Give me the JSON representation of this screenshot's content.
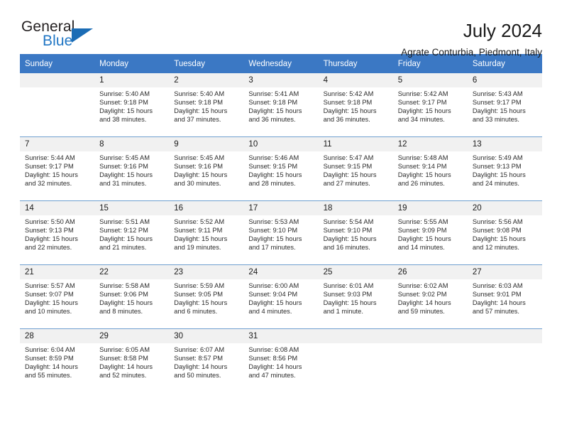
{
  "brand": {
    "name_top": "General",
    "name_bottom": "Blue",
    "triangle_color": "#1b6cb5",
    "blue_text_color": "#2076c4"
  },
  "header": {
    "title": "July 2024",
    "subtitle": "Agrate Conturbia, Piedmont, Italy"
  },
  "theme": {
    "header_bar_color": "#3b78c4",
    "daynum_band_color": "#f1f1f1",
    "row_separator_color": "#6f9fd0",
    "text_color": "#1a1a1a"
  },
  "weekday_headers": [
    "Sunday",
    "Monday",
    "Tuesday",
    "Wednesday",
    "Thursday",
    "Friday",
    "Saturday"
  ],
  "weeks": [
    [
      {
        "day": "",
        "empty": true,
        "sunrise": "",
        "sunset": "",
        "daylight_line1": "",
        "daylight_line2": ""
      },
      {
        "day": "1",
        "empty": false,
        "sunrise": "Sunrise: 5:40 AM",
        "sunset": "Sunset: 9:18 PM",
        "daylight_line1": "Daylight: 15 hours",
        "daylight_line2": "and 38 minutes."
      },
      {
        "day": "2",
        "empty": false,
        "sunrise": "Sunrise: 5:40 AM",
        "sunset": "Sunset: 9:18 PM",
        "daylight_line1": "Daylight: 15 hours",
        "daylight_line2": "and 37 minutes."
      },
      {
        "day": "3",
        "empty": false,
        "sunrise": "Sunrise: 5:41 AM",
        "sunset": "Sunset: 9:18 PM",
        "daylight_line1": "Daylight: 15 hours",
        "daylight_line2": "and 36 minutes."
      },
      {
        "day": "4",
        "empty": false,
        "sunrise": "Sunrise: 5:42 AM",
        "sunset": "Sunset: 9:18 PM",
        "daylight_line1": "Daylight: 15 hours",
        "daylight_line2": "and 36 minutes."
      },
      {
        "day": "5",
        "empty": false,
        "sunrise": "Sunrise: 5:42 AM",
        "sunset": "Sunset: 9:17 PM",
        "daylight_line1": "Daylight: 15 hours",
        "daylight_line2": "and 34 minutes."
      },
      {
        "day": "6",
        "empty": false,
        "sunrise": "Sunrise: 5:43 AM",
        "sunset": "Sunset: 9:17 PM",
        "daylight_line1": "Daylight: 15 hours",
        "daylight_line2": "and 33 minutes."
      }
    ],
    [
      {
        "day": "7",
        "empty": false,
        "sunrise": "Sunrise: 5:44 AM",
        "sunset": "Sunset: 9:17 PM",
        "daylight_line1": "Daylight: 15 hours",
        "daylight_line2": "and 32 minutes."
      },
      {
        "day": "8",
        "empty": false,
        "sunrise": "Sunrise: 5:45 AM",
        "sunset": "Sunset: 9:16 PM",
        "daylight_line1": "Daylight: 15 hours",
        "daylight_line2": "and 31 minutes."
      },
      {
        "day": "9",
        "empty": false,
        "sunrise": "Sunrise: 5:45 AM",
        "sunset": "Sunset: 9:16 PM",
        "daylight_line1": "Daylight: 15 hours",
        "daylight_line2": "and 30 minutes."
      },
      {
        "day": "10",
        "empty": false,
        "sunrise": "Sunrise: 5:46 AM",
        "sunset": "Sunset: 9:15 PM",
        "daylight_line1": "Daylight: 15 hours",
        "daylight_line2": "and 28 minutes."
      },
      {
        "day": "11",
        "empty": false,
        "sunrise": "Sunrise: 5:47 AM",
        "sunset": "Sunset: 9:15 PM",
        "daylight_line1": "Daylight: 15 hours",
        "daylight_line2": "and 27 minutes."
      },
      {
        "day": "12",
        "empty": false,
        "sunrise": "Sunrise: 5:48 AM",
        "sunset": "Sunset: 9:14 PM",
        "daylight_line1": "Daylight: 15 hours",
        "daylight_line2": "and 26 minutes."
      },
      {
        "day": "13",
        "empty": false,
        "sunrise": "Sunrise: 5:49 AM",
        "sunset": "Sunset: 9:13 PM",
        "daylight_line1": "Daylight: 15 hours",
        "daylight_line2": "and 24 minutes."
      }
    ],
    [
      {
        "day": "14",
        "empty": false,
        "sunrise": "Sunrise: 5:50 AM",
        "sunset": "Sunset: 9:13 PM",
        "daylight_line1": "Daylight: 15 hours",
        "daylight_line2": "and 22 minutes."
      },
      {
        "day": "15",
        "empty": false,
        "sunrise": "Sunrise: 5:51 AM",
        "sunset": "Sunset: 9:12 PM",
        "daylight_line1": "Daylight: 15 hours",
        "daylight_line2": "and 21 minutes."
      },
      {
        "day": "16",
        "empty": false,
        "sunrise": "Sunrise: 5:52 AM",
        "sunset": "Sunset: 9:11 PM",
        "daylight_line1": "Daylight: 15 hours",
        "daylight_line2": "and 19 minutes."
      },
      {
        "day": "17",
        "empty": false,
        "sunrise": "Sunrise: 5:53 AM",
        "sunset": "Sunset: 9:10 PM",
        "daylight_line1": "Daylight: 15 hours",
        "daylight_line2": "and 17 minutes."
      },
      {
        "day": "18",
        "empty": false,
        "sunrise": "Sunrise: 5:54 AM",
        "sunset": "Sunset: 9:10 PM",
        "daylight_line1": "Daylight: 15 hours",
        "daylight_line2": "and 16 minutes."
      },
      {
        "day": "19",
        "empty": false,
        "sunrise": "Sunrise: 5:55 AM",
        "sunset": "Sunset: 9:09 PM",
        "daylight_line1": "Daylight: 15 hours",
        "daylight_line2": "and 14 minutes."
      },
      {
        "day": "20",
        "empty": false,
        "sunrise": "Sunrise: 5:56 AM",
        "sunset": "Sunset: 9:08 PM",
        "daylight_line1": "Daylight: 15 hours",
        "daylight_line2": "and 12 minutes."
      }
    ],
    [
      {
        "day": "21",
        "empty": false,
        "sunrise": "Sunrise: 5:57 AM",
        "sunset": "Sunset: 9:07 PM",
        "daylight_line1": "Daylight: 15 hours",
        "daylight_line2": "and 10 minutes."
      },
      {
        "day": "22",
        "empty": false,
        "sunrise": "Sunrise: 5:58 AM",
        "sunset": "Sunset: 9:06 PM",
        "daylight_line1": "Daylight: 15 hours",
        "daylight_line2": "and 8 minutes."
      },
      {
        "day": "23",
        "empty": false,
        "sunrise": "Sunrise: 5:59 AM",
        "sunset": "Sunset: 9:05 PM",
        "daylight_line1": "Daylight: 15 hours",
        "daylight_line2": "and 6 minutes."
      },
      {
        "day": "24",
        "empty": false,
        "sunrise": "Sunrise: 6:00 AM",
        "sunset": "Sunset: 9:04 PM",
        "daylight_line1": "Daylight: 15 hours",
        "daylight_line2": "and 4 minutes."
      },
      {
        "day": "25",
        "empty": false,
        "sunrise": "Sunrise: 6:01 AM",
        "sunset": "Sunset: 9:03 PM",
        "daylight_line1": "Daylight: 15 hours",
        "daylight_line2": "and 1 minute."
      },
      {
        "day": "26",
        "empty": false,
        "sunrise": "Sunrise: 6:02 AM",
        "sunset": "Sunset: 9:02 PM",
        "daylight_line1": "Daylight: 14 hours",
        "daylight_line2": "and 59 minutes."
      },
      {
        "day": "27",
        "empty": false,
        "sunrise": "Sunrise: 6:03 AM",
        "sunset": "Sunset: 9:01 PM",
        "daylight_line1": "Daylight: 14 hours",
        "daylight_line2": "and 57 minutes."
      }
    ],
    [
      {
        "day": "28",
        "empty": false,
        "sunrise": "Sunrise: 6:04 AM",
        "sunset": "Sunset: 8:59 PM",
        "daylight_line1": "Daylight: 14 hours",
        "daylight_line2": "and 55 minutes."
      },
      {
        "day": "29",
        "empty": false,
        "sunrise": "Sunrise: 6:05 AM",
        "sunset": "Sunset: 8:58 PM",
        "daylight_line1": "Daylight: 14 hours",
        "daylight_line2": "and 52 minutes."
      },
      {
        "day": "30",
        "empty": false,
        "sunrise": "Sunrise: 6:07 AM",
        "sunset": "Sunset: 8:57 PM",
        "daylight_line1": "Daylight: 14 hours",
        "daylight_line2": "and 50 minutes."
      },
      {
        "day": "31",
        "empty": false,
        "sunrise": "Sunrise: 6:08 AM",
        "sunset": "Sunset: 8:56 PM",
        "daylight_line1": "Daylight: 14 hours",
        "daylight_line2": "and 47 minutes."
      },
      {
        "day": "",
        "empty": true,
        "sunrise": "",
        "sunset": "",
        "daylight_line1": "",
        "daylight_line2": ""
      },
      {
        "day": "",
        "empty": true,
        "sunrise": "",
        "sunset": "",
        "daylight_line1": "",
        "daylight_line2": ""
      },
      {
        "day": "",
        "empty": true,
        "sunrise": "",
        "sunset": "",
        "daylight_line1": "",
        "daylight_line2": ""
      }
    ]
  ]
}
